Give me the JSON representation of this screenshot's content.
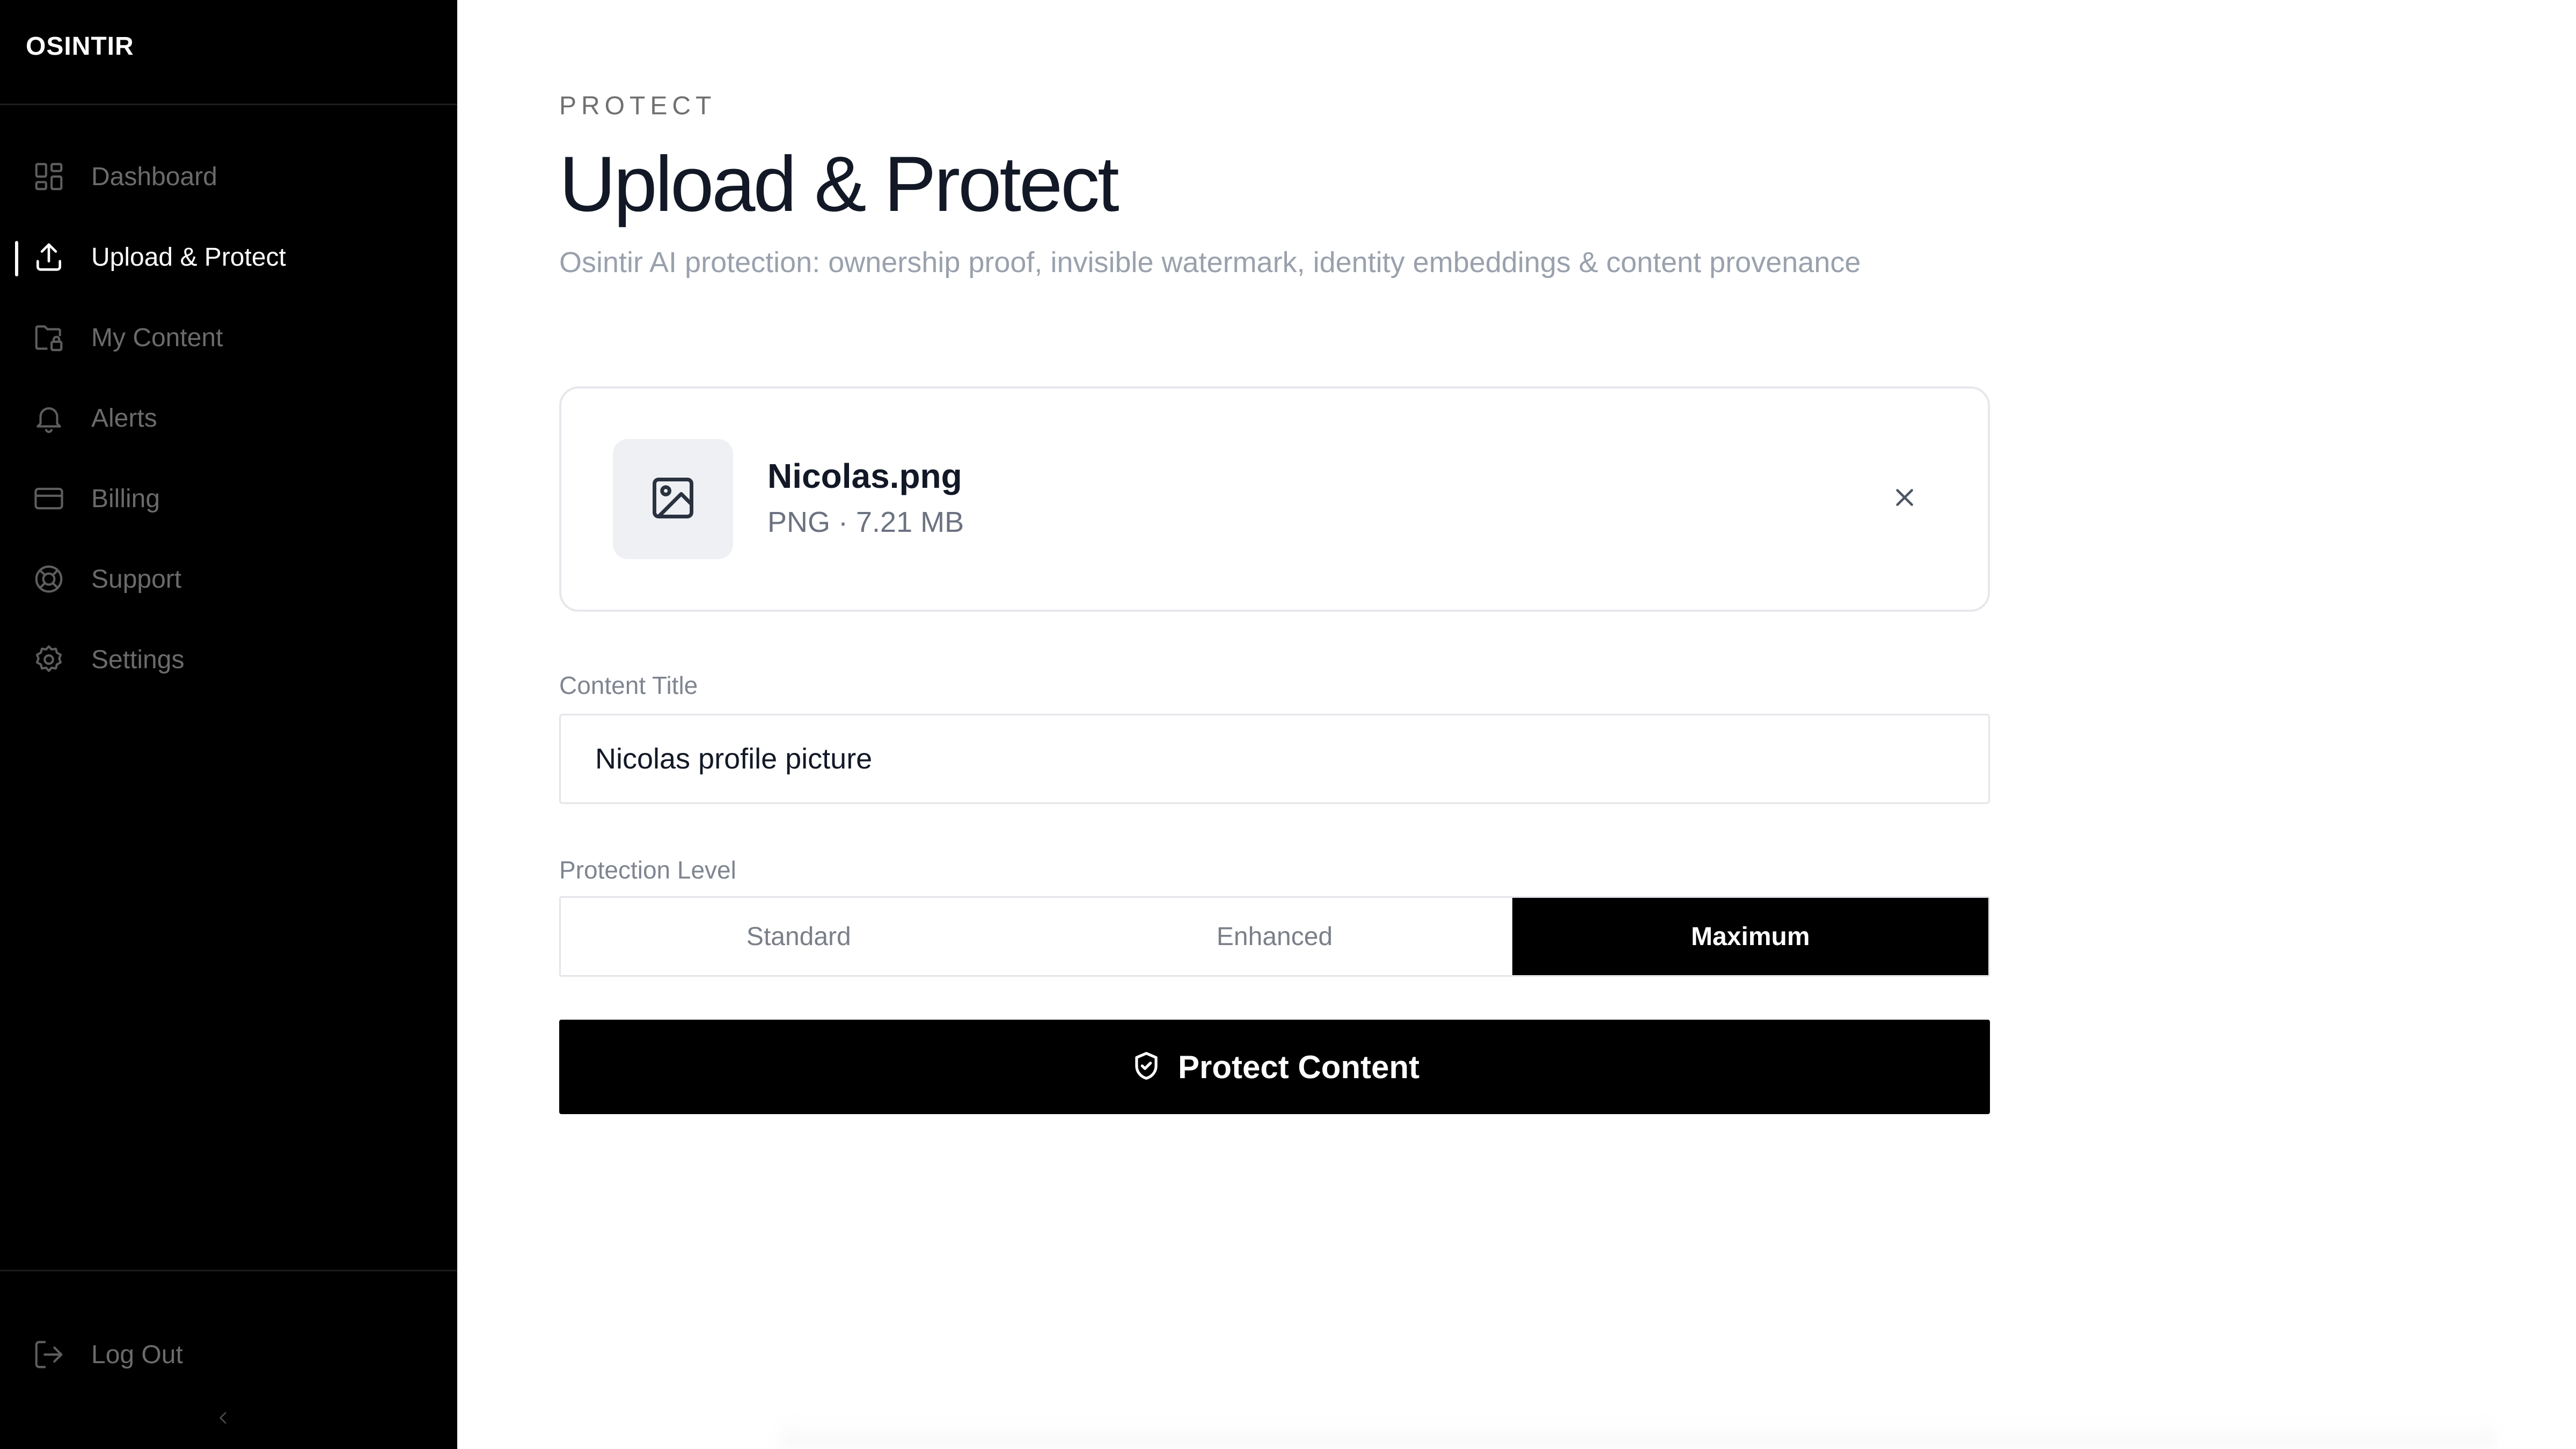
{
  "brand": {
    "name": "OSINTIR"
  },
  "sidebar": {
    "items": [
      {
        "label": "Dashboard",
        "icon": "dashboard-icon"
      },
      {
        "label": "Upload & Protect",
        "icon": "upload-icon",
        "active": true
      },
      {
        "label": "My Content",
        "icon": "folder-lock-icon"
      },
      {
        "label": "Alerts",
        "icon": "bell-icon"
      },
      {
        "label": "Billing",
        "icon": "credit-card-icon"
      },
      {
        "label": "Support",
        "icon": "lifebuoy-icon"
      },
      {
        "label": "Settings",
        "icon": "gear-icon"
      }
    ],
    "logout": {
      "label": "Log Out",
      "icon": "logout-icon"
    },
    "collapse_icon": "chevron-left-icon"
  },
  "header": {
    "eyebrow": "PROTECT",
    "title": "Upload & Protect",
    "subtitle": "Osintir AI protection: ownership proof, invisible watermark, identity embeddings & content provenance"
  },
  "file": {
    "name": "Nicolas.png",
    "meta": "PNG · 7.21 MB",
    "icon": "image-icon",
    "remove_icon": "close-icon"
  },
  "form": {
    "title_label": "Content Title",
    "title_value": "Nicolas profile picture",
    "level_label": "Protection Level",
    "levels": [
      "Standard",
      "Enhanced",
      "Maximum"
    ],
    "selected_level": "Maximum"
  },
  "action": {
    "label": "Protect Content",
    "icon": "shield-check-icon"
  },
  "colors": {
    "sidebar_bg": "#000000",
    "accent": "#000000",
    "muted_text": "#9aa1ad",
    "border": "#e3e5e9"
  }
}
